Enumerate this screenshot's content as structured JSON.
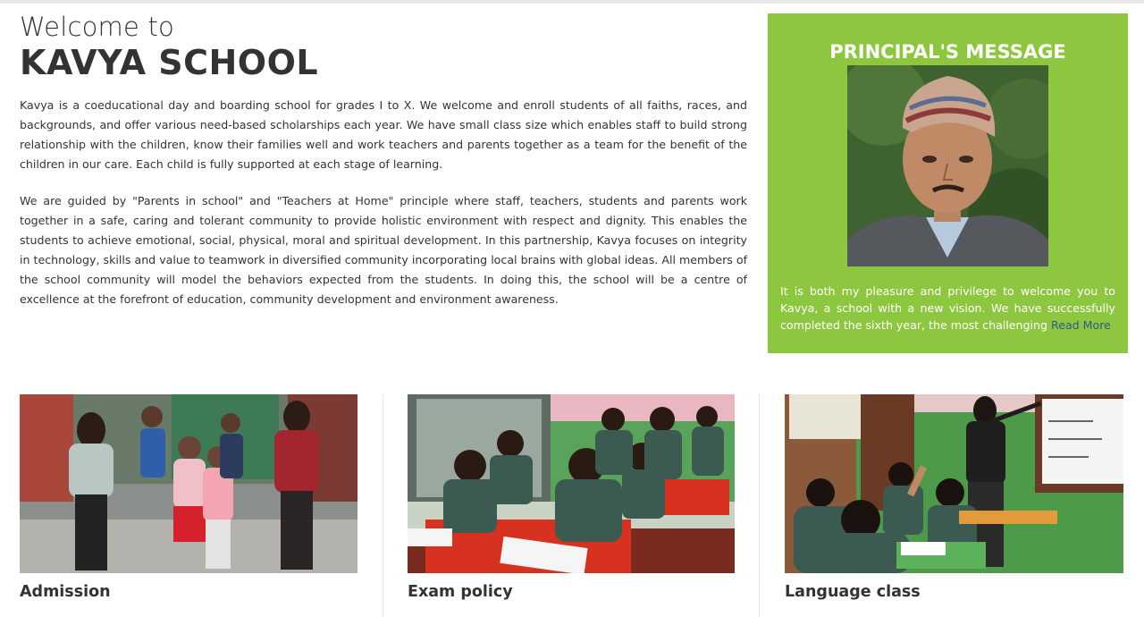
{
  "intro": {
    "welcome": "Welcome to",
    "school_name": "KAVYA SCHOOL",
    "paragraph1": "Kavya is a coeducational day and boarding school for grades I to X. We welcome and enroll students of all faiths, races, and backgrounds, and offer various need-based scholarships each year. We have small class size which enables staff to build strong relationship with the children, know their families well and work teachers and parents together as a team for the benefit of the children in our care. Each child is fully supported at each stage of learning.",
    "paragraph2": "We are guided by \"Parents in school\" and \"Teachers at Home\" principle where staff, teachers, students and parents work together in a safe, caring and tolerant community to provide holistic environment with respect and dignity. This enables the students to achieve emotional, social, physical, moral and spiritual development. In this partnership, Kavya focuses on integrity in technology, skills and value to teamwork in diversified community incorporating local brains with global ideas. All members of the school community will model the behaviors expected from the students. In doing this, the school will be a centre of excellence at the forefront of education, community development and environment awareness."
  },
  "principal": {
    "title": "PRINCIPAL'S MESSAGE",
    "message": "It is both my pleasure and privilege to welcome you to Kavya, a school with a new vision. We have successfully completed the sixth year, the most challenging ",
    "read_more": "Read More",
    "accent_color": "#8dc63f"
  },
  "cards": [
    {
      "title": "Admission",
      "image": "students-walking-photo"
    },
    {
      "title": "Exam policy",
      "image": "students-exam-photo"
    },
    {
      "title": "Language class",
      "image": "language-class-photo"
    }
  ]
}
